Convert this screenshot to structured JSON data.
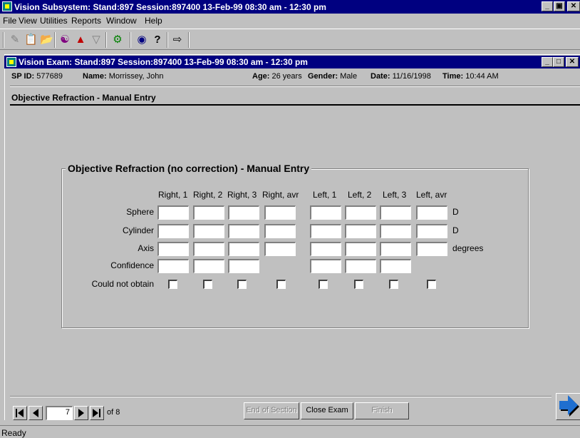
{
  "app": {
    "title": "Vision Subsystem: Stand:897 Session:897400 13-Feb-99 08:30 am - 12:30 pm",
    "menu": [
      "File",
      "View",
      "Utilities",
      "Reports",
      "Window",
      "Help"
    ]
  },
  "window": {
    "title": "Vision Exam: Stand:897 Session:897400 13-Feb-99 08:30 am - 12:30 pm"
  },
  "patient": {
    "sp_id_label": "SP ID:",
    "sp_id": "577689",
    "name_label": "Name:",
    "name": "Morrissey, John",
    "age_label": "Age:",
    "age": "26 years",
    "gender_label": "Gender:",
    "gender": "Male",
    "date_label": "Date:",
    "date": "11/16/1998",
    "time_label": "Time:",
    "time": "10:44 AM"
  },
  "section_title": "Objective Refraction - Manual Entry",
  "group": {
    "title": "Objective Refraction (no correction) - Manual Entry",
    "columns": [
      "Right, 1",
      "Right, 2",
      "Right, 3",
      "Right, avr",
      "Left, 1",
      "Left, 2",
      "Left, 3",
      "Left, avr"
    ],
    "rows": {
      "sphere": {
        "label": "Sphere",
        "unit": "D"
      },
      "cylinder": {
        "label": "Cylinder",
        "unit": "D"
      },
      "axis": {
        "label": "Axis",
        "unit": "degrees"
      },
      "confidence": {
        "label": "Confidence"
      },
      "could_not_obtain": {
        "label": "Could not obtain"
      }
    }
  },
  "nav": {
    "page": "7",
    "of_label": "of 8",
    "end_of_section": "End of Section",
    "close_exam": "Close Exam",
    "finish": "Finish"
  },
  "status": "Ready",
  "colors": {
    "title_bar": "#000080",
    "face": "#c0c0c0",
    "next_arrow": "#1f6fd0"
  }
}
